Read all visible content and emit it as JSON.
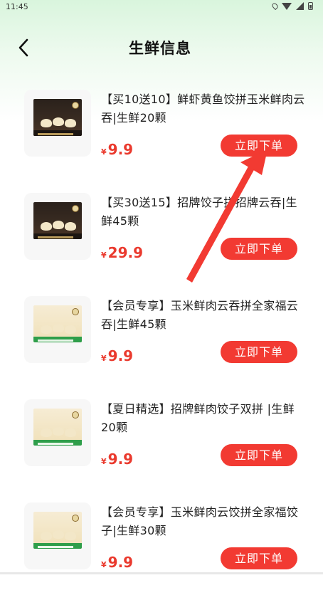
{
  "status_bar": {
    "time": "11:45",
    "icons": [
      "location-icon",
      "wifi-icon",
      "signal-icon",
      "battery-icon"
    ]
  },
  "header": {
    "title": "生鲜信息",
    "back_icon": "chevron-left-icon"
  },
  "colors": {
    "accent": "#f23a32",
    "price": "#ea3a2e",
    "header_gradient_top": "#d9f5dd"
  },
  "products": [
    {
      "name": "【买10送10】鲜虾黄鱼饺拼玉米鲜肉云吞|生鲜20颗",
      "currency": "¥",
      "price": "9.9",
      "button": "立即下单",
      "image_style": "dark"
    },
    {
      "name": "【买30送15】招牌饺子拼招牌云吞|生鲜45颗",
      "currency": "¥",
      "price": "29.9",
      "button": "立即下单",
      "image_style": "dark"
    },
    {
      "name": "【会员专享】玉米鲜肉云吞拼全家福云吞|生鲜45颗",
      "currency": "¥",
      "price": "9.9",
      "button": "立即下单",
      "image_style": "light"
    },
    {
      "name": "【夏日精选】招牌鲜肉饺子双拼 |生鲜20颗",
      "currency": "¥",
      "price": "9.9",
      "button": "立即下单",
      "image_style": "light"
    },
    {
      "name": "【会员专享】玉米鲜肉云饺拼全家福饺子|生鲜30颗",
      "currency": "¥",
      "price": "9.9",
      "button": "立即下单",
      "image_style": "light"
    }
  ],
  "annotation": {
    "type": "arrow",
    "color": "#f23a32",
    "points_to": "first-order-button"
  }
}
